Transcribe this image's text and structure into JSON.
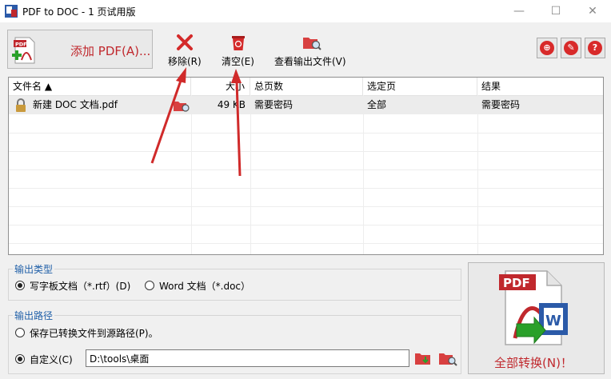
{
  "window": {
    "title": "PDF to DOC - 1 页试用版",
    "minimize": "—",
    "maximize": "☐",
    "close": "✕"
  },
  "toolbar": {
    "add_pdf_label": "添加 PDF(A)...",
    "remove_label": "移除(R)",
    "clear_label": "清空(E)",
    "view_output_label": "查看输出文件(V)",
    "right_icons": [
      "globe-icon",
      "key-icon",
      "help-icon"
    ],
    "right_icon_glyphs": [
      "⊕",
      "✎",
      "?"
    ]
  },
  "table": {
    "columns": [
      "文件名 ▲",
      "大小",
      "总页数",
      "选定页",
      "结果"
    ],
    "rows": [
      {
        "name": "新建 DOC 文档.pdf",
        "size": "49 KB",
        "pages": "需要密码",
        "selected": "全部",
        "result": "需要密码"
      }
    ]
  },
  "output_type": {
    "title": "输出类型",
    "options": [
      "写字板文档（*.rtf）(D)",
      "Word 文档（*.doc）"
    ],
    "selected_index": 0
  },
  "output_path": {
    "title": "输出路径",
    "source_option": "保存已转换文件到源路径(P)。",
    "custom_option": "自定义(C)",
    "path_value": "D:\\tools\\桌面",
    "selected": "custom"
  },
  "convert": {
    "label": "全部转换(N)！"
  },
  "colors": {
    "accent_red": "#c0282d",
    "group_title_blue": "#1f5fa8"
  }
}
